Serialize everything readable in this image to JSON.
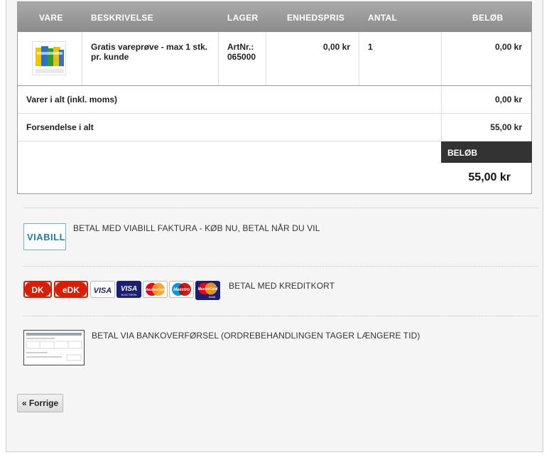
{
  "cart": {
    "columns": {
      "vare": "VARE",
      "beskrivelse": "BESKRIVELSE",
      "lager": "LAGER",
      "enhedspris": "ENHEDSPRIS",
      "antal": "ANTAL",
      "belob": "BELØB"
    },
    "item": {
      "description_line1": "Gratis vareprøve - max 1 stk.",
      "description_line2": "pr. kunde",
      "artnr_label": "ArtNr.:",
      "artnr_value": "065000",
      "unit_price": "0,00 kr",
      "quantity": "1",
      "amount": "0,00 kr",
      "thumb_site_text": "www.meine.dk"
    },
    "summary": {
      "items_total_label": "Varer i alt (inkl. moms)",
      "items_total_value": "0,00 kr",
      "shipping_label": "Forsendelse i alt",
      "shipping_value": "55,00 kr",
      "total_header": "BELØB",
      "total_value": "55,00 kr"
    }
  },
  "payment": {
    "viabill": {
      "label": "BETAL MED VIABILL FAKTURA - KØB NU, BETAL NÅR DU VIL",
      "logo_text": "VIABILL",
      "logo_color": "#1a7fb0"
    },
    "card": {
      "label": "BETAL MED KREDITKORT",
      "logos": {
        "dankort": "DK",
        "edankort": "eDK",
        "visa": "VISA",
        "visa_electron": "VISA",
        "visa_electron_sub": "ELECTRON",
        "mastercard": "MasterCard",
        "maestro": "Maestro",
        "mastercard_debit": "MasterCard",
        "debit": "Debit"
      }
    },
    "bank": {
      "label": "BETAL VIA BANKOVERFØRSEL (ORDREBEHANDLINGEN TAGER LÆNGERE TID)"
    }
  },
  "nav": {
    "back_label": "« Forrige"
  },
  "colors": {
    "header_bg": "#999999",
    "dark_box": "#333333",
    "dankort_red": "#d81e05",
    "visa_blue": "#1a1f71",
    "mastercard_red": "#eb001b",
    "mastercard_orange": "#f79e1b"
  }
}
